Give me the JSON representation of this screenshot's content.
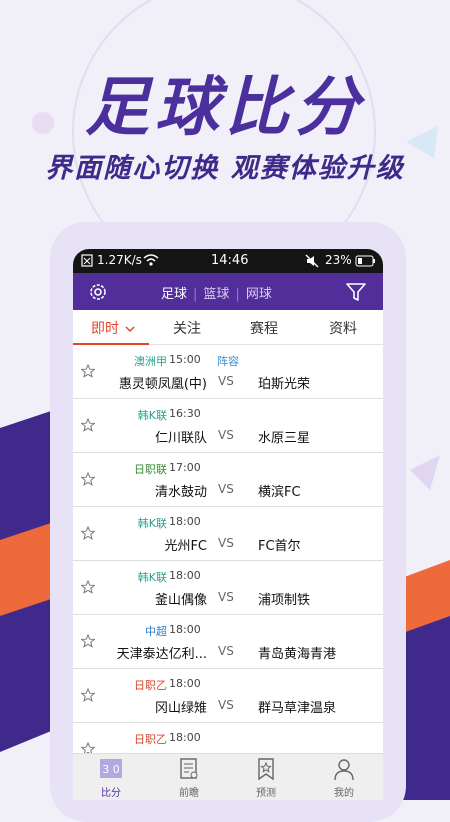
{
  "promo": {
    "headline": "足球比分",
    "subline": "界面随心切换  观赛体验升级"
  },
  "status_bar": {
    "speed": "1.27K/s",
    "time": "14:46",
    "battery": "23%"
  },
  "app_bar": {
    "tabs": [
      "足球",
      "篮球",
      "网球"
    ],
    "active_tab": "足球"
  },
  "sub_tabs": {
    "items": [
      "即时",
      "关注",
      "赛程",
      "资料"
    ],
    "active": "即时"
  },
  "matches": [
    {
      "league": "澳洲甲",
      "league_color": "#2a9d8f",
      "time": "15:00",
      "lineup": "阵容",
      "home": "惠灵顿凤凰(中)",
      "vs": "VS",
      "away": "珀斯光荣"
    },
    {
      "league": "韩K联",
      "league_color": "#2a9d8f",
      "time": "16:30",
      "home": "仁川联队",
      "vs": "VS",
      "away": "水原三星"
    },
    {
      "league": "日职联",
      "league_color": "#3a8d3a",
      "time": "17:00",
      "home": "清水鼓动",
      "vs": "VS",
      "away": "横滨FC"
    },
    {
      "league": "韩K联",
      "league_color": "#2a9d8f",
      "time": "18:00",
      "home": "光州FC",
      "vs": "VS",
      "away": "FC首尔"
    },
    {
      "league": "韩K联",
      "league_color": "#2a9d8f",
      "time": "18:00",
      "home": "釜山偶像",
      "vs": "VS",
      "away": "浦项制铁"
    },
    {
      "league": "中超",
      "league_color": "#2a7fc4",
      "time": "18:00",
      "home": "天津泰达亿利...",
      "vs": "VS",
      "away": "青岛黄海青港"
    },
    {
      "league": "日职乙",
      "league_color": "#d9462e",
      "time": "18:00",
      "home": "冈山绿雉",
      "vs": "VS",
      "away": "群马草津温泉"
    },
    {
      "league": "日职乙",
      "league_color": "#d9462e",
      "time": "18:00",
      "home": "",
      "vs": "",
      "away": ""
    }
  ],
  "bottom_nav": {
    "items": [
      {
        "label": "比分",
        "icon": "scoreboard-icon",
        "active": true,
        "icon_text": "3 0"
      },
      {
        "label": "前瞻",
        "icon": "document-icon",
        "active": false
      },
      {
        "label": "预测",
        "icon": "bookmark-star-icon",
        "active": false
      },
      {
        "label": "我的",
        "icon": "user-icon",
        "active": false
      }
    ]
  },
  "colors": {
    "brand_purple": "#512e9a",
    "accent_red": "#e2452b",
    "background": "#f1eff8"
  }
}
